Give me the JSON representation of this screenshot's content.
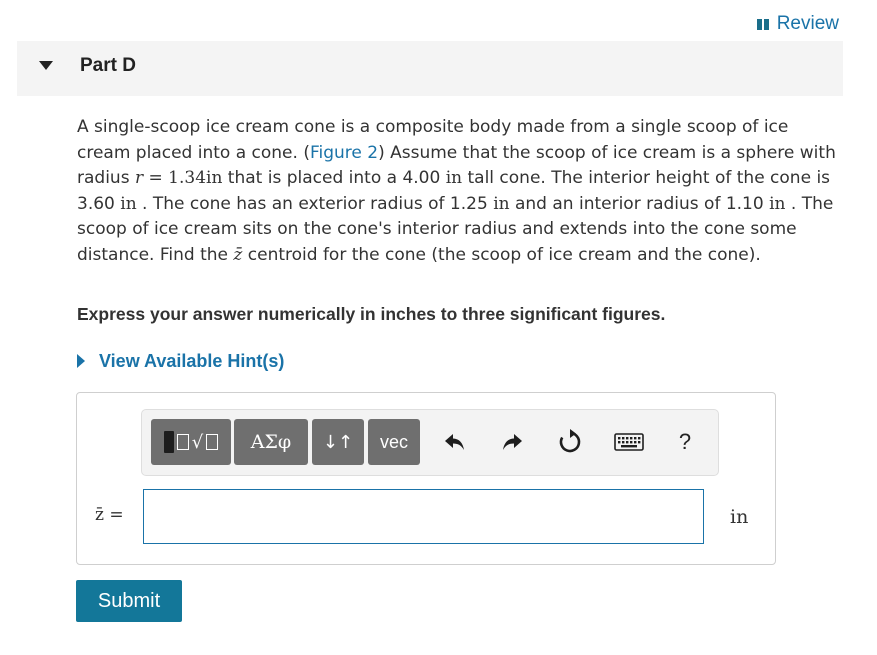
{
  "header": {
    "review_label": "Review"
  },
  "part": {
    "title": "Part D"
  },
  "problem": {
    "s1": "A single-scoop ice cream cone is a composite body made from a single scoop of ice cream placed into a cone. (",
    "figure_link": "Figure 2",
    "s2": ") Assume that the scoop of ice cream is a sphere with radius ",
    "r_var": "r",
    "r_eq": " = 1.34",
    "r_unit": "in",
    "s3": " that is placed into a 4.00 ",
    "tall_unit": "in",
    "s4": " tall cone. The interior height of the cone is 3.60 ",
    "h_unit": "in",
    "s5": " . The cone has an exterior radius of 1.25 ",
    "ext_unit": "in",
    "s6": " and an interior radius of 1.10 ",
    "int_unit": "in",
    "s7": " . The scoop of ice cream sits on the cone's interior radius and extends into the cone some distance. Find the ",
    "zbar": "z̄",
    "s8": " centroid for the cone (the scoop of ice cream and the cone)."
  },
  "instruction": "Express your answer numerically in inches to three significant figures.",
  "hint_label": "View Available Hint(s)",
  "toolbar": {
    "greek_label": "ΑΣφ",
    "arrows_label": "↓↑",
    "vec_label": "vec",
    "help_label": "?"
  },
  "answer": {
    "variable_label": "z̄ =",
    "value": "",
    "placeholder": "",
    "unit": "in"
  },
  "submit_label": "Submit",
  "colors": {
    "link": "#1a73a8",
    "submit_bg": "#137799",
    "toolbar_btn": "#6f6f6f"
  }
}
